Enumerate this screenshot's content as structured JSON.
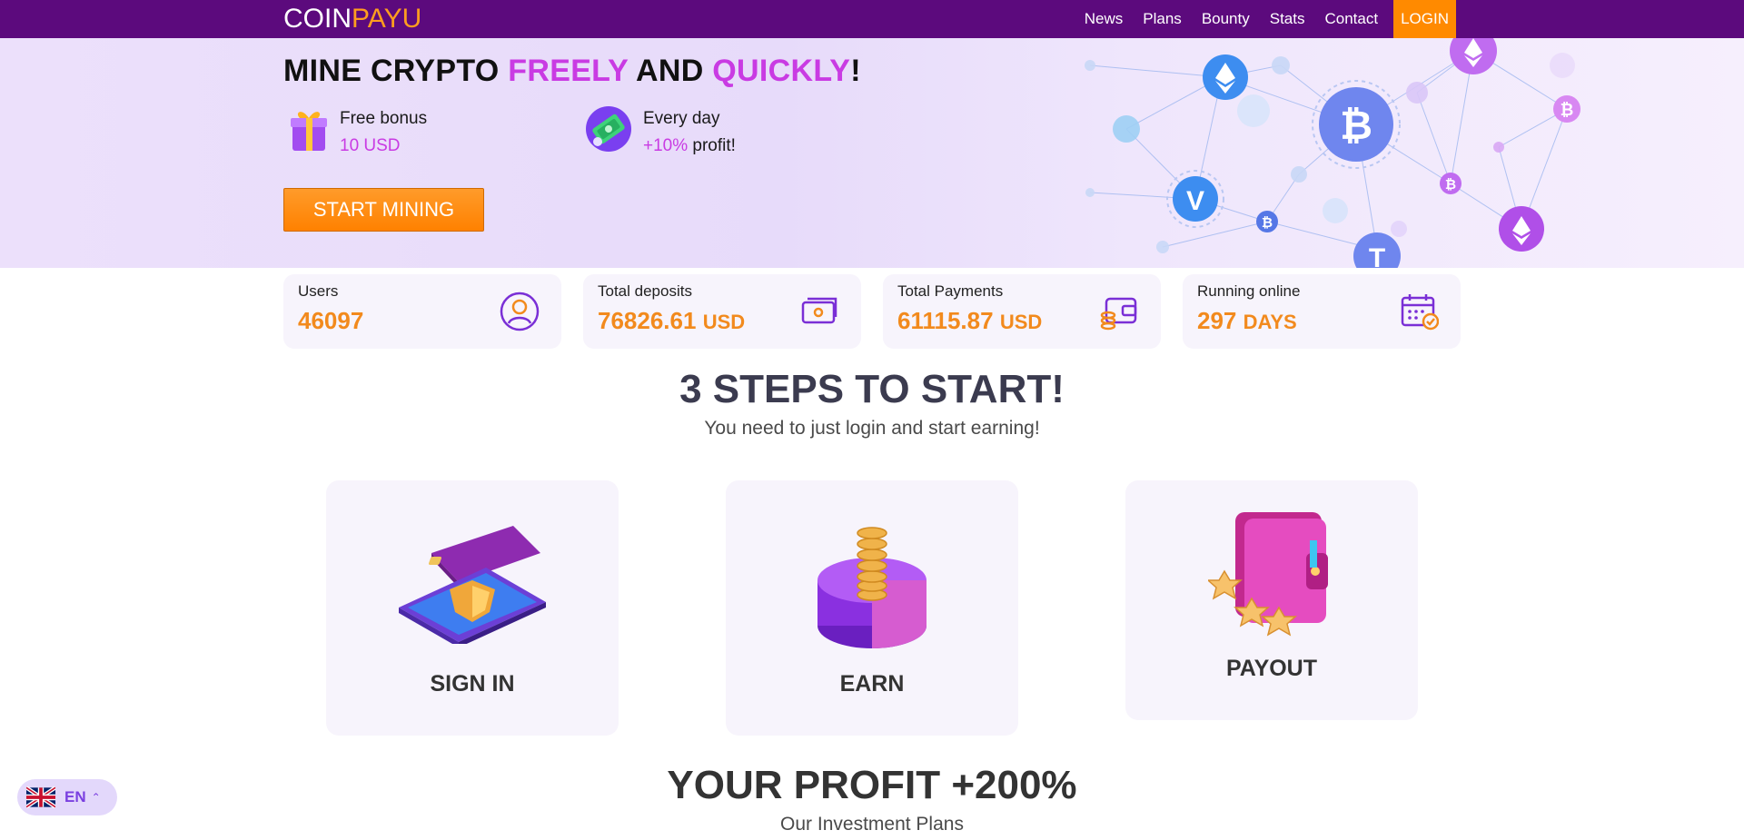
{
  "brand": {
    "part1": "COIN",
    "part2": "PAYU"
  },
  "nav": {
    "items": [
      "News",
      "Plans",
      "Bounty",
      "Stats",
      "Contact"
    ],
    "login": "LOGIN"
  },
  "hero": {
    "title_1": "MINE CRYPTO ",
    "title_2": "FREELY",
    "title_3": " AND ",
    "title_4": "QUICKLY",
    "title_5": "!",
    "bonus": {
      "line1": "Free bonus",
      "line2": "10 USD"
    },
    "daily": {
      "line1": "Every day",
      "line2a": "+10%",
      "line2b": " profit!"
    },
    "cta": "START MINING"
  },
  "stats": [
    {
      "label": "Users",
      "value": "46097",
      "unit": "",
      "icon": "user-circle-icon"
    },
    {
      "label": "Total deposits",
      "value": "76826.61",
      "unit": "USD",
      "icon": "cash-icon"
    },
    {
      "label": "Total Payments",
      "value": "61115.87",
      "unit": "USD",
      "icon": "wallet-coins-icon"
    },
    {
      "label": "Running online",
      "value": "297",
      "unit": "DAYS",
      "icon": "calendar-check-icon"
    }
  ],
  "steps": {
    "title": "3 STEPS TO START!",
    "subtitle": "You need to just login and start earning!",
    "items": [
      "SIGN IN",
      "EARN",
      "PAYOUT"
    ]
  },
  "profit": {
    "title": "YOUR PROFIT +200%",
    "subtitle": "Our Investment Plans"
  },
  "language": {
    "code": "EN"
  },
  "colors": {
    "nav_bg": "#5c0a7d",
    "accent_orange": "#ff8a00",
    "accent_purple": "#c93be3",
    "stat_value": "#f28a1d"
  }
}
